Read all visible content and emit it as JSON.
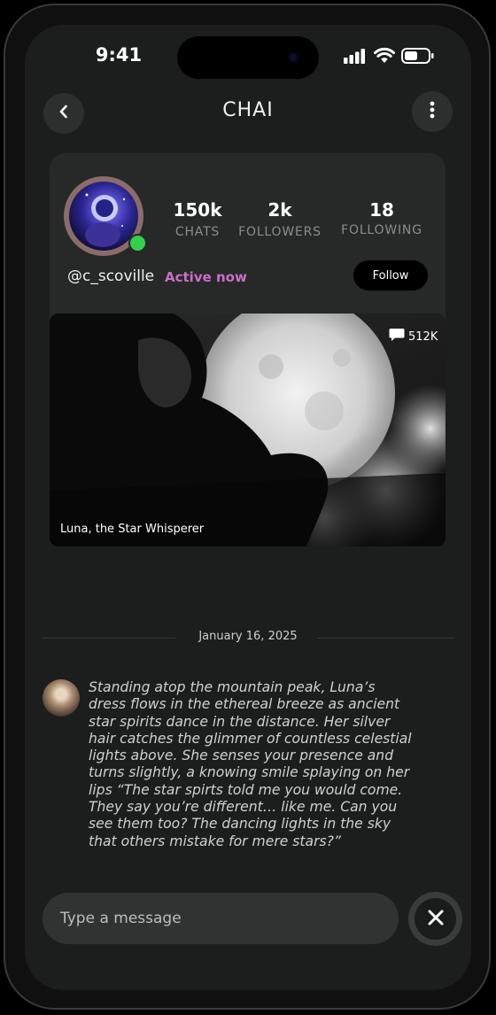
{
  "status_bar": {
    "time": "9:41"
  },
  "header": {
    "title": "CHAI"
  },
  "profile": {
    "stats": [
      {
        "value": "150k",
        "label": "CHATS"
      },
      {
        "value": "2k",
        "label": "FOLLOWERS"
      },
      {
        "value": "18",
        "label": "FOLLOWING"
      }
    ],
    "handle": "@c_scoville",
    "status": "Active now",
    "follow_label": "Follow"
  },
  "hero": {
    "caption": "Luna, the Star Whisperer",
    "chat_count": "512K"
  },
  "chat": {
    "date": "January 16, 2025",
    "message": "Standing atop the mountain peak, Luna’s dress flows in the ethereal breeze as ancient star spirits dance in the distance. Her silver hair catches the glimmer of countless celestial lights above. She senses your presence and turns slightly, a knowing smile splaying on her lips “The star spirts told me you would come. They say you’re different… like me. Can you see them too? The dancing lights in the sky that others mistake for mere stars?”"
  },
  "composer": {
    "placeholder": "Type a message"
  },
  "icons": {
    "back": "chevron-left-icon",
    "menu": "more-vertical-icon",
    "signal": "signal-icon",
    "wifi": "wifi-icon",
    "battery": "battery-icon",
    "chat_bubble": "chat-bubble-icon",
    "close": "close-icon"
  },
  "colors": {
    "accent_status": "#c96fc6",
    "online": "#35d04a",
    "background": "#1c1d1d",
    "card": "#272828"
  }
}
